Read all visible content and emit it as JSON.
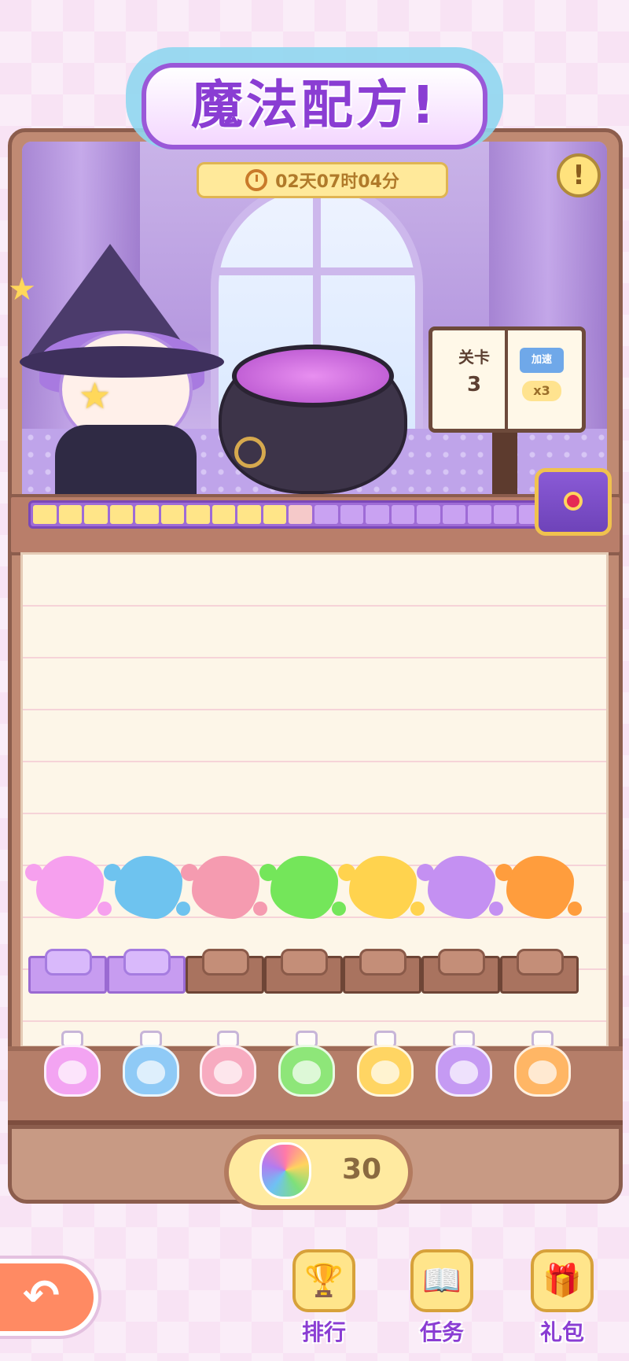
{
  "header": {
    "title": "魔法配方!",
    "timer": "02天07时04分",
    "info_symbol": "!"
  },
  "level": {
    "label": "关卡",
    "number": "3",
    "speed_label": "加速",
    "speed_multiplier": "x3"
  },
  "progress": {
    "total_segments": 20,
    "filled_segments": 10,
    "partial_segment": 1,
    "fill_color": "#ffe588",
    "empty_color": "#c9a2f2"
  },
  "colors": {
    "splashes": [
      "#f6a0ee",
      "#6ec3ef",
      "#f59bb0",
      "#74e65a",
      "#ffd34e",
      "#c490f2",
      "#ff9d3d"
    ],
    "bottles": [
      "#f3a4f2",
      "#8fcaf6",
      "#f7abc0",
      "#8ee679",
      "#ffd563",
      "#c59af3",
      "#ffb665"
    ]
  },
  "slots": {
    "open_count": 2,
    "total": 7
  },
  "currency": {
    "count": "30",
    "icon": "rainbow-bottle-icon"
  },
  "nav": {
    "back_symbol": "↶",
    "items": [
      {
        "label": "排行",
        "icon": "trophy-icon"
      },
      {
        "label": "任务",
        "icon": "task-book-icon"
      },
      {
        "label": "礼包",
        "icon": "gift-icon"
      }
    ]
  }
}
